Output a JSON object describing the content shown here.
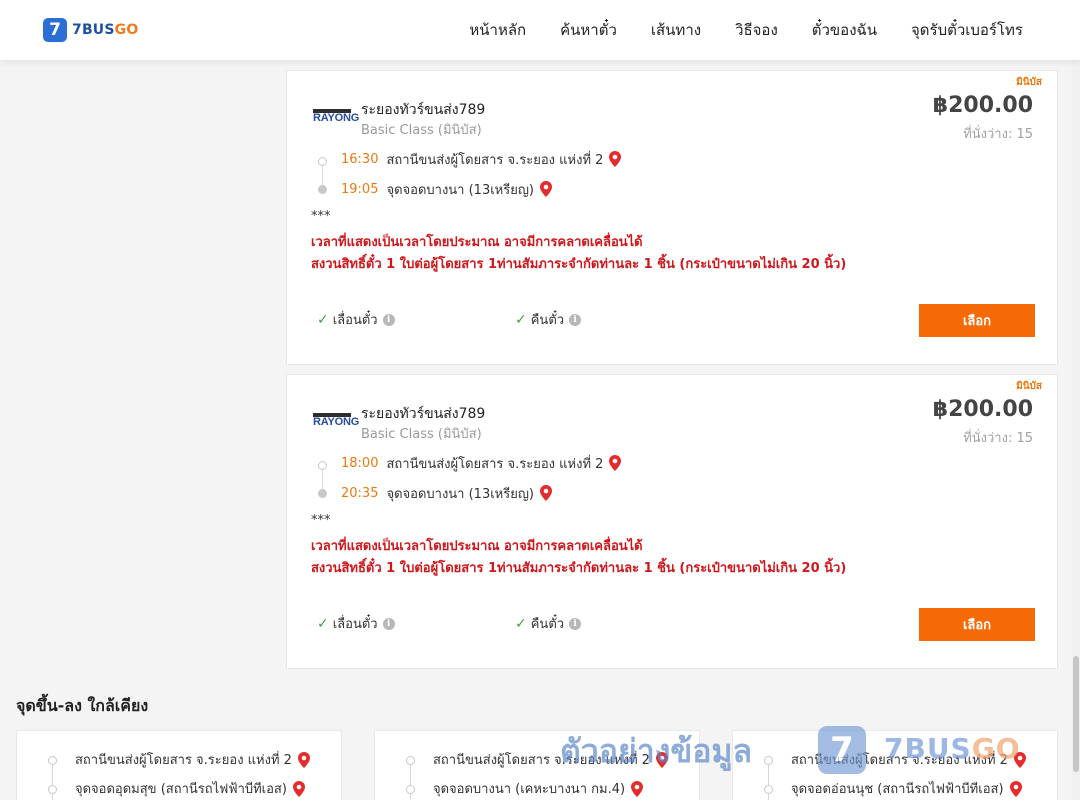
{
  "header": {
    "logo_mark": "7",
    "logo_brand": "7BUS",
    "logo_brand_go": "GO",
    "nav": [
      "หน้าหลัก",
      "ค้นหาตั๋ว",
      "เส้นทาง",
      "วิธีจอง",
      "ตั๋วของฉัน",
      "จุดรับตั๋วเบอร์โทร"
    ]
  },
  "trips": [
    {
      "badge": "มินิบัส",
      "operator_logo_text": "RAYONG",
      "operator": "ระยองทัวร์ขนส่ง789",
      "class": "Basic Class (มินิบัส)",
      "price": "฿200.00",
      "seats": "ที่นั่งว่าง: 15",
      "depart_time": "16:30",
      "depart_stop": "สถานีขนส่งผู้โดยสาร จ.ระยอง แห่งที่ 2",
      "arrive_time": "19:05",
      "arrive_stop": "จุดจอดบางนา (13เหรียญ)",
      "note_stars": "***",
      "note_line1": "เวลาที่แสดงเป็นเวลาโดยประมาณ อาจมีการคลาดเคลื่อนได้",
      "note_line2": "สงวนสิทธิ์ตั๋ว 1 ใบต่อผู้โดยสาร 1ท่านสัมภาระจำกัดท่านละ 1 ชิ้น (กระเป๋าขนาดไม่เกิน 20 นิ้ว)",
      "feature1": "เลื่อนตั๋ว",
      "feature2": "คืนตั๋ว",
      "select_label": "เลือก"
    },
    {
      "badge": "มินิบัส",
      "operator_logo_text": "RAYONG",
      "operator": "ระยองทัวร์ขนส่ง789",
      "class": "Basic Class (มินิบัส)",
      "price": "฿200.00",
      "seats": "ที่นั่งว่าง: 15",
      "depart_time": "18:00",
      "depart_stop": "สถานีขนส่งผู้โดยสาร จ.ระยอง แห่งที่ 2",
      "arrive_time": "20:35",
      "arrive_stop": "จุดจอดบางนา (13เหรียญ)",
      "note_stars": "***",
      "note_line1": "เวลาที่แสดงเป็นเวลาโดยประมาณ อาจมีการคลาดเคลื่อนได้",
      "note_line2": "สงวนสิทธิ์ตั๋ว 1 ใบต่อผู้โดยสาร 1ท่านสัมภาระจำกัดท่านละ 1 ชิ้น (กระเป๋าขนาดไม่เกิน 20 นิ้ว)",
      "feature1": "เลื่อนตั๋ว",
      "feature2": "คืนตั๋ว",
      "select_label": "เลือก"
    }
  ],
  "nearby": {
    "title": "จุดขึ้น-ลง ใกล้เคียง",
    "cards": [
      {
        "from": "สถานีขนส่งผู้โดยสาร จ.ระยอง แห่งที่ 2",
        "to": "จุดจอดอุดมสุข (สถานีรถไฟฟ้าบีทีเอส)"
      },
      {
        "from": "สถานีขนส่งผู้โดยสาร จ.ระยอง แห่งที่ 2",
        "to": "จุดจอดบางนา (เคหะบางนา กม.4)"
      },
      {
        "from": "สถานีขนส่งผู้โดยสาร จ.ระยอง แห่งที่ 2",
        "to": "จุดจอดอ่อนนุช (สถานีรถไฟฟ้าบีทีเอส)"
      }
    ]
  },
  "watermark": {
    "text": "ตัวอย่างข้อมูล",
    "mark": "7",
    "brand": "7BUS",
    "brand_go": "GO"
  },
  "colors": {
    "accent": "#f56a07",
    "time": "#ea7a10",
    "warning": "#d0171c",
    "brand_blue": "#2b6fd6"
  },
  "icons": {
    "pin": "map-pin-icon",
    "check": "check-icon",
    "info": "info-icon"
  }
}
